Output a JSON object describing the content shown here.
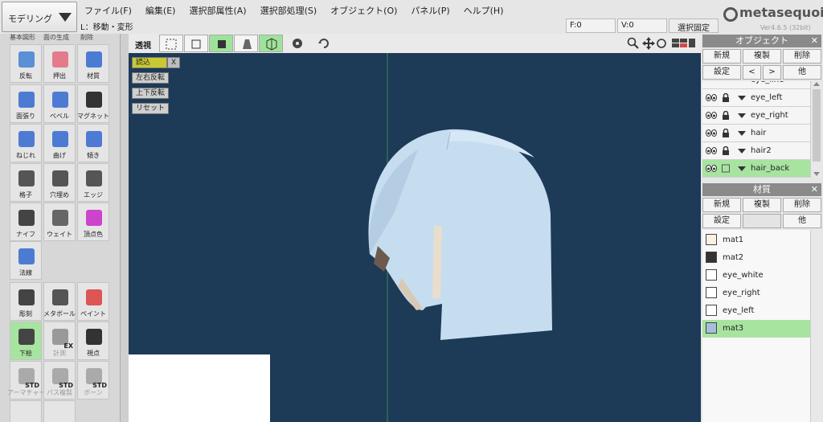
{
  "mode_select": {
    "label": "モデリング"
  },
  "menu": [
    "ファイル(F)",
    "編集(E)",
    "選択部属性(A)",
    "選択部処理(S)",
    "オブジェクト(O)",
    "パネル(P)",
    "ヘルプ(H)"
  ],
  "status": {
    "tool": "L：移動・変形",
    "face_count": "F:0",
    "vertex_count": "V:0",
    "fix_button": "選択固定"
  },
  "logo": {
    "text": "metasequoia4",
    "version": "Ver4.6.5 (32bit)"
  },
  "tool_sections": {
    "partial_top": [
      "基本図形",
      "面の生成",
      "削除"
    ],
    "tools": [
      {
        "label": "反転",
        "icon": "flip-icon"
      },
      {
        "label": "押出",
        "icon": "extrude-icon"
      },
      {
        "label": "材質",
        "icon": "material-icon"
      },
      {
        "label": "面張り",
        "icon": "face-fill-icon"
      },
      {
        "label": "ベベル",
        "icon": "bevel-icon"
      },
      {
        "label": "マグネット",
        "icon": "magnet-icon"
      },
      {
        "label": "ねじれ",
        "icon": "twist-icon"
      },
      {
        "label": "曲げ",
        "icon": "bend-icon"
      },
      {
        "label": "傾き",
        "icon": "tilt-icon"
      },
      {
        "label": "格子",
        "icon": "lattice-icon"
      },
      {
        "label": "穴埋め",
        "icon": "fill-hole-icon"
      },
      {
        "label": "エッジ",
        "icon": "edge-icon"
      },
      {
        "label": "ナイフ",
        "icon": "knife-icon"
      },
      {
        "label": "ウェイト",
        "icon": "weight-icon"
      },
      {
        "label": "頂点色",
        "icon": "vertex-color-icon"
      },
      {
        "label": "法線",
        "icon": "normal-icon"
      },
      {
        "label": "彫刻",
        "icon": "sculpt-icon"
      },
      {
        "label": "メタボール",
        "icon": "metaball-icon"
      },
      {
        "label": "ペイント",
        "icon": "paint-icon"
      },
      {
        "label": "下絵",
        "icon": "underlay-icon"
      },
      {
        "label": "計測",
        "icon": "measure-icon"
      },
      {
        "label": "視点",
        "icon": "camera-icon"
      },
      {
        "label": "アーマチャー",
        "icon": "armature-icon"
      },
      {
        "label": "パス複製",
        "icon": "path-copy-icon"
      },
      {
        "label": "ボーン",
        "icon": "bone-icon"
      }
    ],
    "ex_badge": "EX",
    "std_badge": "STD"
  },
  "viewport": {
    "perspective_label": "透視",
    "buttons": [
      "読込",
      "X",
      "左右反転",
      "上下反転",
      "リセット"
    ]
  },
  "object_panel": {
    "title": "オブジェクト",
    "buttons": [
      "新規",
      "複製",
      "削除",
      "設定",
      "<",
      ">",
      "他"
    ],
    "partial_item": "eye_line",
    "items": [
      "eye_left",
      "eye_right",
      "hair",
      "hair2",
      "hair_back"
    ],
    "selected": "hair_back"
  },
  "material_panel": {
    "title": "材質",
    "buttons": [
      "新規",
      "複製",
      "削除",
      "設定",
      "他"
    ],
    "items": [
      {
        "name": "mat1",
        "color": "#faf0e4"
      },
      {
        "name": "mat2",
        "color": "#333333"
      },
      {
        "name": "eye_white",
        "color": "#ffffff"
      },
      {
        "name": "eye_right",
        "color": "#ffffff"
      },
      {
        "name": "eye_left",
        "color": "#ffffff"
      },
      {
        "name": "mat3",
        "color": "#a6bfd9"
      }
    ],
    "selected": "mat3"
  },
  "colors": {
    "active_green": "#a7e4a0",
    "viewport_bg": "#1d3a57",
    "hair": "#c9e0f2"
  }
}
